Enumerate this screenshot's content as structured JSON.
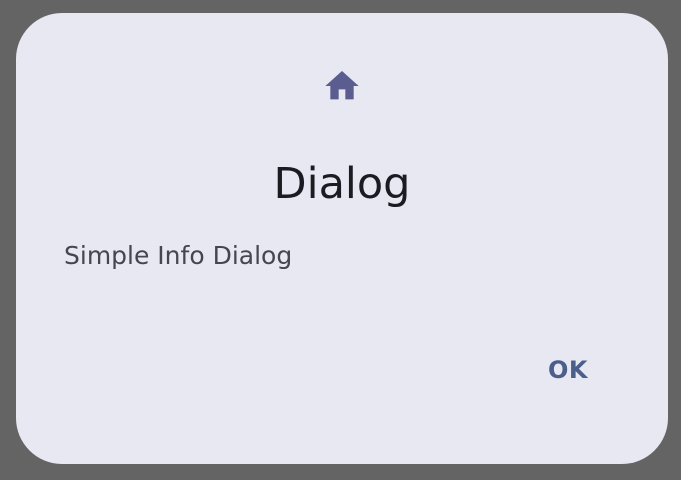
{
  "dialog": {
    "icon": "home-icon",
    "title": "Dialog",
    "message": "Simple Info Dialog",
    "confirm_label": "OK"
  },
  "colors": {
    "scrim": "#646464",
    "surface": "#e8e8f3",
    "icon": "#5b5c8f",
    "title": "#1b1b21",
    "body": "#46464f",
    "accent": "#4c5e8c"
  }
}
